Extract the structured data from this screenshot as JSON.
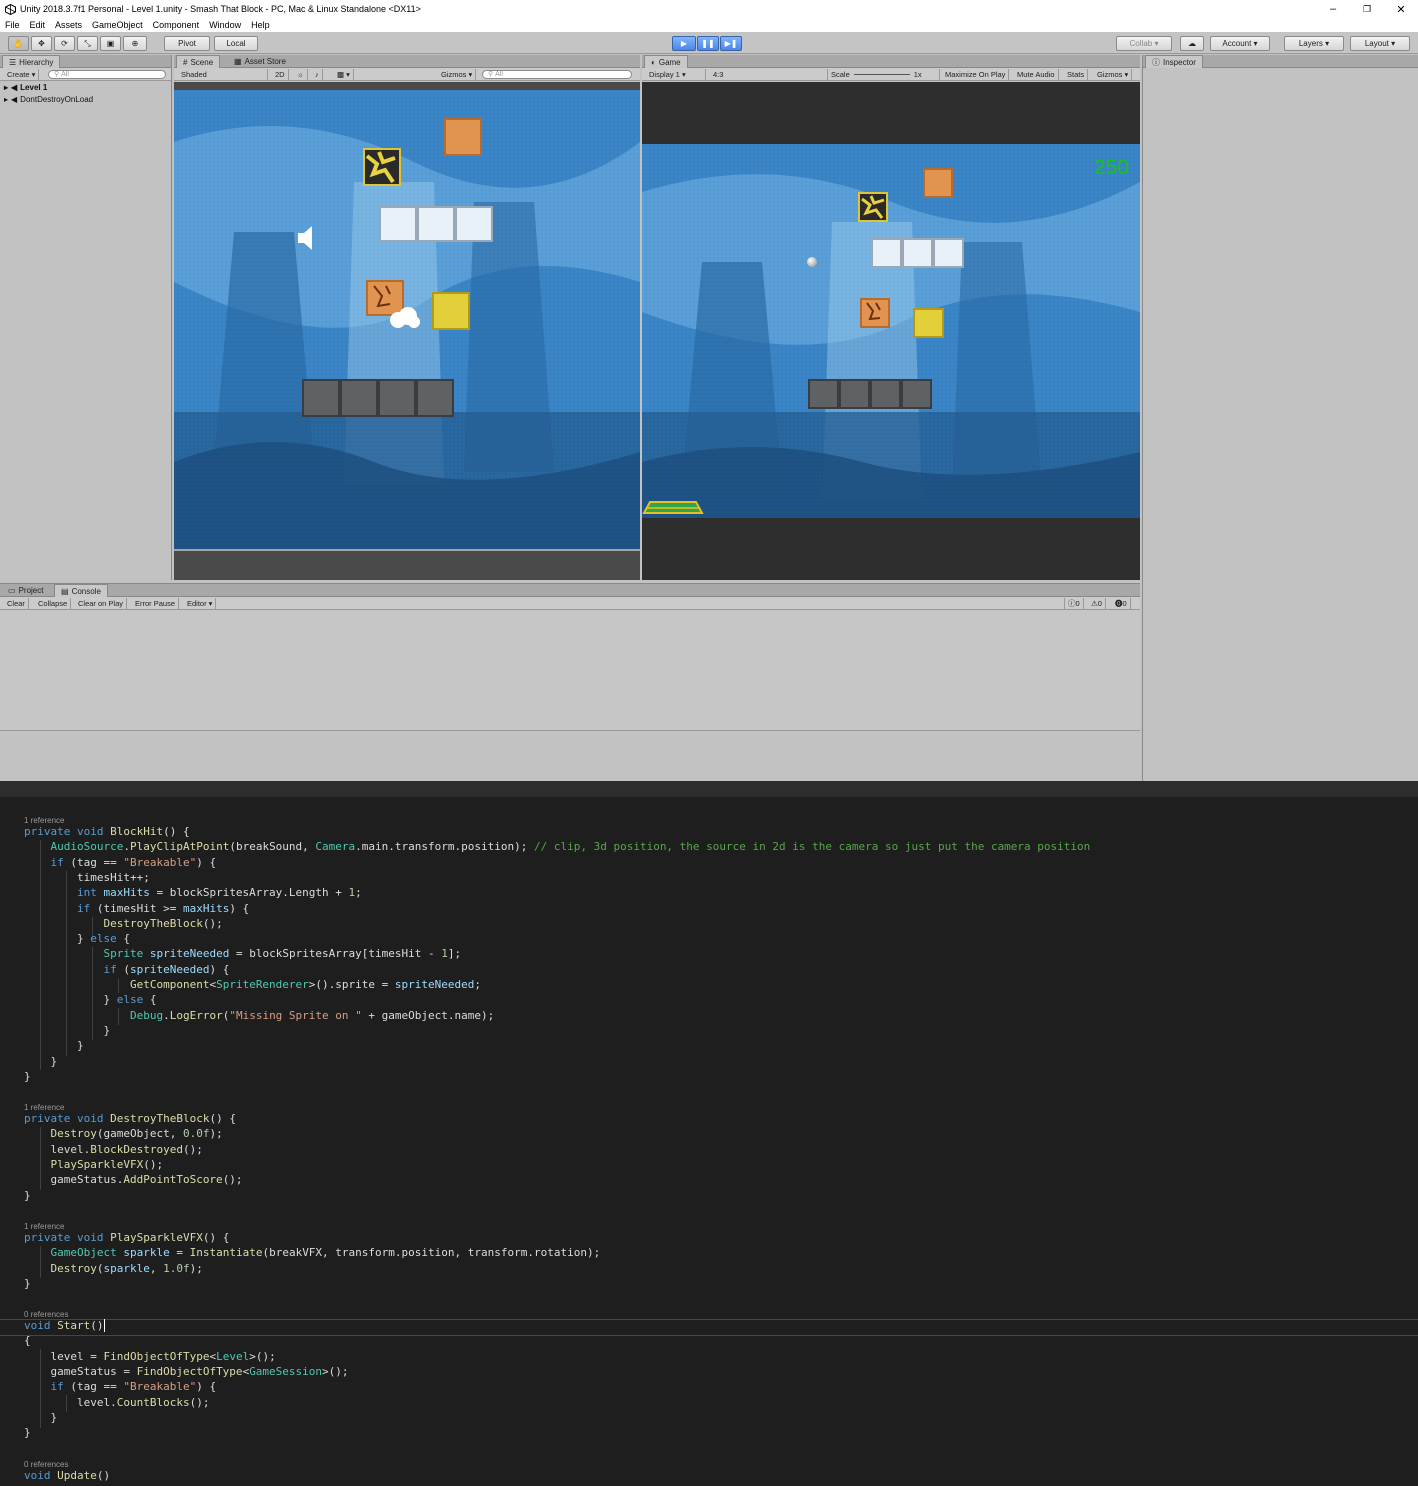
{
  "window": {
    "title": "Unity 2018.3.7f1 Personal - Level 1.unity - Smash That Block - PC, Mac & Linux Standalone <DX11>",
    "minimize": "–",
    "maximize": "❐",
    "close": "✕"
  },
  "menu": [
    "File",
    "Edit",
    "Assets",
    "GameObject",
    "Component",
    "Window",
    "Help"
  ],
  "toolbar": {
    "pivot": "Pivot",
    "local": "Local",
    "collab": "Collab",
    "account": "Account",
    "layers": "Layers",
    "layout": "Layout"
  },
  "hierarchy": {
    "tab": "Hierarchy",
    "create": "Create",
    "search": "All",
    "items": [
      "Level 1",
      "DontDestroyOnLoad"
    ]
  },
  "scene": {
    "tab_scene": "Scene",
    "tab_store": "Asset Store",
    "shading": "Shaded",
    "mode2d": "2D",
    "gizmos": "Gizmos",
    "search": "All"
  },
  "game": {
    "tab": "Game",
    "display": "Display 1",
    "aspect": "4:3",
    "scale_label": "Scale",
    "scale_value": "1x",
    "maximize": "Maximize On Play",
    "mute": "Mute Audio",
    "stats": "Stats",
    "gizmos": "Gizmos",
    "score": "250"
  },
  "console": {
    "tab_project": "Project",
    "tab_console": "Console",
    "clear": "Clear",
    "collapse": "Collapse",
    "clear_on_play": "Clear on Play",
    "error_pause": "Error Pause",
    "editor": "Editor",
    "count_info": "0",
    "count_warn": "0",
    "count_error": "0"
  },
  "inspector": {
    "tab": "Inspector"
  },
  "colors": {
    "score": "#19c419",
    "sky": "#3a84c8",
    "code_bg": "#1e1e1e"
  },
  "code": {
    "refs": [
      "1 reference",
      "1 reference",
      "1 reference",
      "0 references",
      "0 references"
    ]
  }
}
